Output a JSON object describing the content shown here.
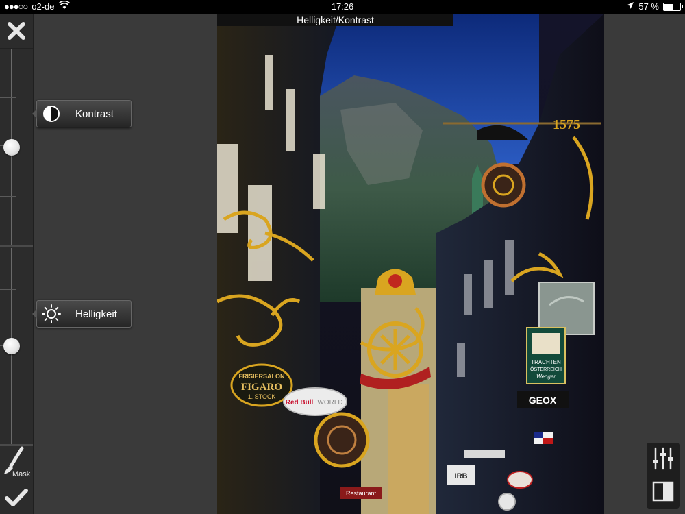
{
  "status": {
    "carrier": "o2-de",
    "time": "17:26",
    "battery_text": "57 %",
    "battery_level": 0.57
  },
  "app": {
    "title": "Helligkeit/Kontrast"
  },
  "tools": {
    "kontrast_label": "Kontrast",
    "helligkeit_label": "Helligkeit",
    "mask_label": "Mask",
    "kontrast_level": 0.5,
    "helligkeit_level": 0.5
  },
  "photo": {
    "sign_frisiersalon": "FRISIERSALON",
    "sign_figaro": "FIGARO",
    "sign_stock": "1. STOCK",
    "sign_redbull": "Red Bull",
    "sign_world": "WORLD",
    "sign_geox": "GEOX",
    "sign_year": "1575",
    "sign_trachten": "TRACHTEN",
    "sign_oesterreich": "ÖSTERREICH",
    "sign_wenger": "Wenger",
    "sign_irb": "IRB",
    "sign_restaurant": "Restaurant"
  },
  "colors": {
    "panel": "#3a3a3a",
    "strip": "#2c2c2c",
    "sky": "#1a3a8a",
    "gold": "#d9a520"
  }
}
